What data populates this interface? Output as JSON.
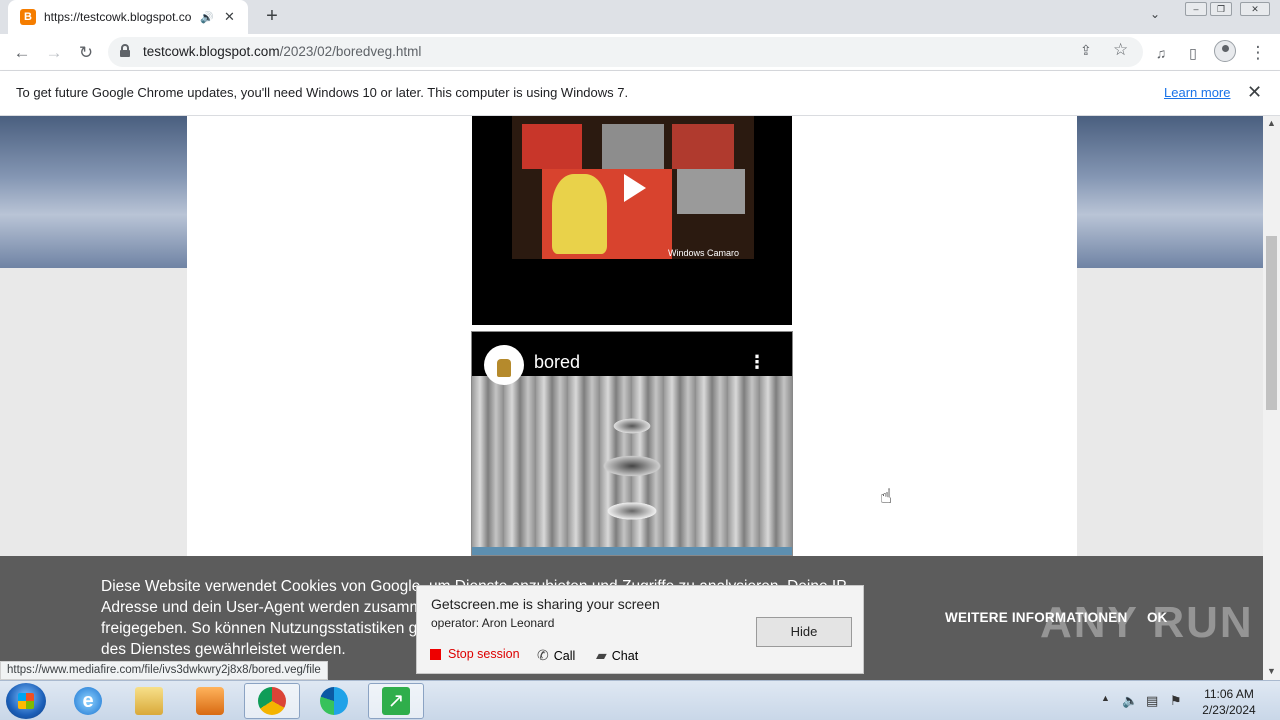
{
  "browser": {
    "tab": {
      "favicon": "B",
      "title": "https://testcowk.blogspot.co",
      "audio_icon": "speaker-icon",
      "close": "✕"
    },
    "new_tab": "+",
    "url": {
      "host": "testcowk.blogspot.com",
      "path": "/2023/02/boredveg.html"
    },
    "window_controls": [
      "–",
      "❐",
      "✕"
    ]
  },
  "infobar": {
    "message": "To get future Google Chrome updates, you'll need Windows 10 or later. This computer is using Windows 7.",
    "link": "Learn more",
    "close": "✕"
  },
  "page": {
    "video1": {
      "caption": "Windows Camaro"
    },
    "video2": {
      "channel": "bored",
      "menu": "⋮"
    },
    "cookie_banner": {
      "text": "Diese Website verwendet Cookies von Google, um Dienste anzubieten und Zugriffe zu analysieren. Deine IP-Adresse und dein User-Agent werden zusammen mit Messwerten zur Leistung und Sicherheit für Google freigegeben. So können Nutzungsstatistiken generiert, Missbrauchsfälle erkannt und behoben und die Qualität des Dienstes gewährleistet werden.",
      "more_info": "WEITERE INFORMATIONEN",
      "ok": "OK"
    },
    "watermark": "ANY RUN"
  },
  "getscreen": {
    "title": "Getscreen.me is sharing your screen",
    "operator": "operator: Aron Leonard",
    "hide": "Hide",
    "stop": "Stop session",
    "call": "Call",
    "chat": "Chat"
  },
  "status_url": "https://www.mediafire.com/file/ivs3dwkwry2j8x8/bored.veg/file",
  "taskbar": {
    "time": "11:06 AM",
    "date": "2/23/2024",
    "apps": [
      "internet-explorer-icon",
      "file-explorer-icon",
      "media-player-icon",
      "chrome-icon",
      "edge-icon",
      "getscreen-icon"
    ]
  }
}
